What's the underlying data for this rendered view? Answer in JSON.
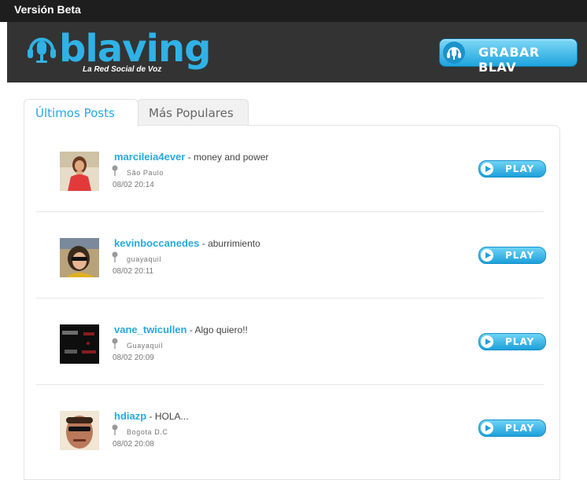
{
  "beta_label": "Versión Beta",
  "logo": {
    "text": "blaving",
    "tagline": "La Red Social de Voz"
  },
  "record_button_label": "GRABAR BLAV",
  "tabs": [
    {
      "label": "Últimos Posts",
      "active": true
    },
    {
      "label": "Más Populares",
      "active": false
    }
  ],
  "play_label": "PLAY",
  "posts": [
    {
      "username": "marcileia4ever",
      "message": "- money and power",
      "location": "São Paulo",
      "timestamp": "08/02 20:14"
    },
    {
      "username": "kevinboccanedes",
      "message": "- aburrimiento",
      "location": "guayaquil",
      "timestamp": "08/02 20:11"
    },
    {
      "username": "vane_twicullen",
      "message": "- Algo quiero!!",
      "location": "Guayaquil",
      "timestamp": "08/02 20:09"
    },
    {
      "username": "hdiazp",
      "message": "- HOLA...",
      "location": "Bogota D.C",
      "timestamp": "08/02 20:08"
    }
  ],
  "colors": {
    "accent": "#26a9e0",
    "top_bar": "#1e1e1e",
    "header": "#333333"
  }
}
